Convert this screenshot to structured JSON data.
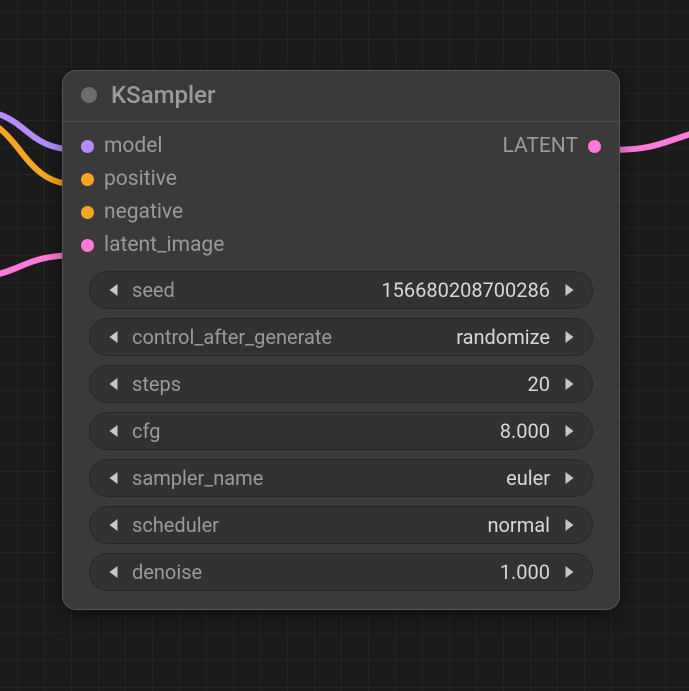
{
  "node": {
    "title": "KSampler",
    "inputs": {
      "model": {
        "label": "model",
        "color": "p-purple"
      },
      "positive": {
        "label": "positive",
        "color": "p-orange"
      },
      "negative": {
        "label": "negative",
        "color": "p-orange"
      },
      "latent_image": {
        "label": "latent_image",
        "color": "p-pink"
      }
    },
    "outputs": {
      "latent": {
        "label": "LATENT",
        "color": "p-pink"
      }
    }
  },
  "params": {
    "seed": {
      "name": "seed",
      "value": "156680208700286"
    },
    "control_after_generate": {
      "name": "control_after_generate",
      "value": "randomize"
    },
    "steps": {
      "name": "steps",
      "value": "20"
    },
    "cfg": {
      "name": "cfg",
      "value": "8.000"
    },
    "sampler_name": {
      "name": "sampler_name",
      "value": "euler"
    },
    "scheduler": {
      "name": "scheduler",
      "value": "normal"
    },
    "denoise": {
      "name": "denoise",
      "value": "1.000"
    }
  },
  "colors": {
    "wire_purple": "#b38cff",
    "wire_orange": "#f5a623",
    "wire_pink": "#ff7ad9"
  }
}
